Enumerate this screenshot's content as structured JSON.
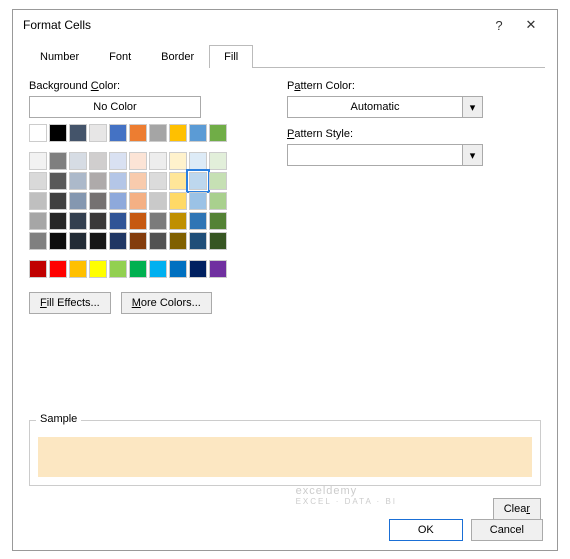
{
  "dialog": {
    "title": "Format Cells"
  },
  "tabs": {
    "items": [
      "Number",
      "Font",
      "Border",
      "Fill"
    ],
    "active": 3
  },
  "bgcolor": {
    "label": "Background Color:",
    "label_u": "C",
    "nocolor": "No Color",
    "row1": [
      "#ffffff",
      "#000000",
      "#44546a",
      "#e7e6e6",
      "#4472c4",
      "#ed7d31",
      "#a5a5a5",
      "#ffc000",
      "#5b9bd5",
      "#70ad47"
    ],
    "grid": [
      [
        "#f2f2f2",
        "#7f7f7f",
        "#d6dce4",
        "#d0cece",
        "#d9e1f2",
        "#fce4d6",
        "#ededed",
        "#fff2cc",
        "#ddebf7",
        "#e2efda"
      ],
      [
        "#d9d9d9",
        "#595959",
        "#acb9ca",
        "#aeaaaa",
        "#b4c6e7",
        "#f8cbad",
        "#dbdbdb",
        "#ffe699",
        "#bdd7ee",
        "#c6e0b4"
      ],
      [
        "#bfbfbf",
        "#404040",
        "#8497b0",
        "#757171",
        "#8ea9db",
        "#f4b084",
        "#c9c9c9",
        "#ffd966",
        "#9bc2e6",
        "#a9d08e"
      ],
      [
        "#a6a6a6",
        "#262626",
        "#333f4f",
        "#3a3838",
        "#305496",
        "#c65911",
        "#7b7b7b",
        "#bf8f00",
        "#2f75b5",
        "#548235"
      ],
      [
        "#808080",
        "#0d0d0d",
        "#222b35",
        "#161616",
        "#203764",
        "#833c0c",
        "#525252",
        "#806000",
        "#1f4e78",
        "#375623"
      ]
    ],
    "standard": [
      "#c00000",
      "#ff0000",
      "#ffc000",
      "#ffff00",
      "#92d050",
      "#00b050",
      "#00b0f0",
      "#0070c0",
      "#002060",
      "#7030a0"
    ],
    "selected": {
      "row": 1,
      "col": 8
    },
    "fill_effects": "Fill Effects...",
    "more_colors": "More Colors..."
  },
  "pattern": {
    "color_label": "Pattern Color:",
    "color_value": "Automatic",
    "style_label": "Pattern Style:",
    "style_value": ""
  },
  "sample": {
    "label": "Sample",
    "color": "#fce7c2"
  },
  "buttons": {
    "clear": "Clear",
    "clear_u": "r",
    "ok": "OK",
    "cancel": "Cancel"
  },
  "watermark": {
    "main": "exceldemy",
    "sub": "EXCEL · DATA · BI"
  },
  "chart_data": null
}
